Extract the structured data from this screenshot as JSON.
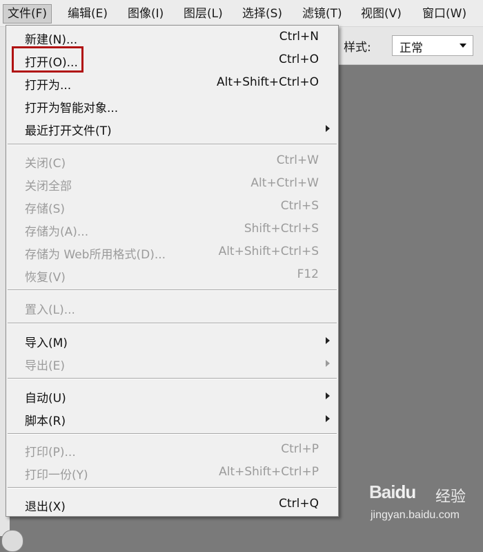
{
  "menubar": {
    "items": [
      {
        "label": "文件(F)",
        "active": true
      },
      {
        "label": "编辑(E)"
      },
      {
        "label": "图像(I)"
      },
      {
        "label": "图层(L)"
      },
      {
        "label": "选择(S)"
      },
      {
        "label": "滤镜(T)"
      },
      {
        "label": "视图(V)"
      },
      {
        "label": "窗口(W)"
      }
    ]
  },
  "options_bar": {
    "style_label": "样式:",
    "style_value": "正常"
  },
  "file_menu": {
    "items": [
      {
        "label": "新建(N)...",
        "shortcut": "Ctrl+N",
        "enabled": true
      },
      {
        "label": "打开(O)...",
        "shortcut": "Ctrl+O",
        "enabled": true,
        "highlighted": true
      },
      {
        "label": "打开为...",
        "shortcut": "Alt+Shift+Ctrl+O",
        "enabled": true
      },
      {
        "label": "打开为智能对象...",
        "shortcut": "",
        "enabled": true
      },
      {
        "label": "最近打开文件(T)",
        "shortcut": "",
        "enabled": true,
        "submenu": true
      },
      {
        "label": "关闭(C)",
        "shortcut": "Ctrl+W",
        "enabled": false
      },
      {
        "label": "关闭全部",
        "shortcut": "Alt+Ctrl+W",
        "enabled": false
      },
      {
        "label": "存储(S)",
        "shortcut": "Ctrl+S",
        "enabled": false
      },
      {
        "label": "存储为(A)...",
        "shortcut": "Shift+Ctrl+S",
        "enabled": false
      },
      {
        "label": "存储为 Web所用格式(D)...",
        "shortcut": "Alt+Shift+Ctrl+S",
        "enabled": false
      },
      {
        "label": "恢复(V)",
        "shortcut": "F12",
        "enabled": false
      },
      {
        "label": "置入(L)...",
        "shortcut": "",
        "enabled": false
      },
      {
        "label": "导入(M)",
        "shortcut": "",
        "enabled": true,
        "submenu": true
      },
      {
        "label": "导出(E)",
        "shortcut": "",
        "enabled": false,
        "submenu": true
      },
      {
        "label": "自动(U)",
        "shortcut": "",
        "enabled": true,
        "submenu": true
      },
      {
        "label": "脚本(R)",
        "shortcut": "",
        "enabled": true,
        "submenu": true
      },
      {
        "label": "打印(P)...",
        "shortcut": "Ctrl+P",
        "enabled": false
      },
      {
        "label": "打印一份(Y)",
        "shortcut": "Alt+Shift+Ctrl+P",
        "enabled": false
      },
      {
        "label": "退出(X)",
        "shortcut": "Ctrl+Q",
        "enabled": true
      }
    ]
  },
  "watermark": {
    "logo": "Bai",
    "logo_paw": "du",
    "brand": "经验",
    "site": "jingyan.baidu.com"
  },
  "colors": {
    "highlight_box": "#b01212",
    "disabled_text": "#9b9b9b",
    "canvas": "#7a7a7a"
  }
}
